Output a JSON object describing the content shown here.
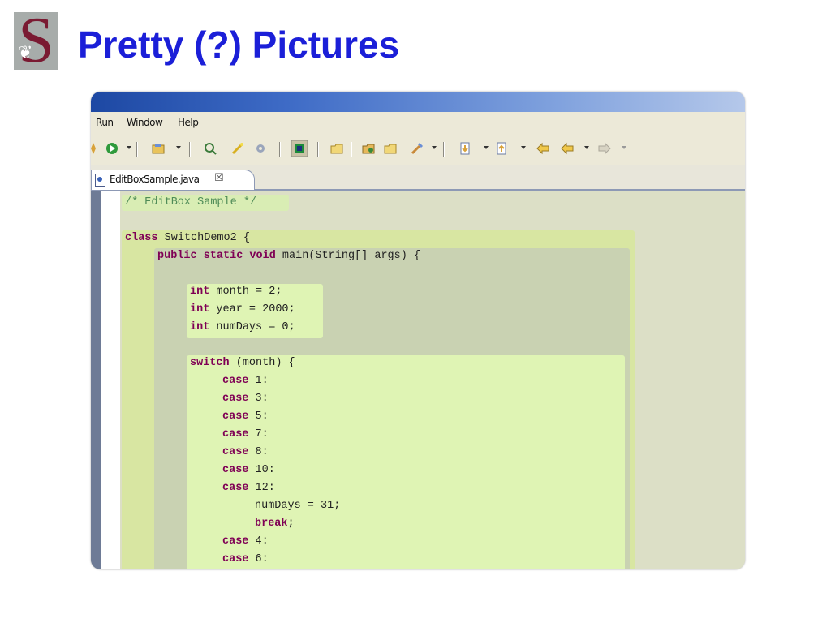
{
  "slide": {
    "title": "Pretty (?) Pictures",
    "logo_letter": "S"
  },
  "menu": [
    {
      "label": "Run",
      "mnemonic": "R"
    },
    {
      "label": "Window",
      "mnemonic": "W"
    },
    {
      "label": "Help",
      "mnemonic": "H"
    }
  ],
  "toolbar_icons": [
    "debug-icon",
    "run-icon",
    "open-type-icon",
    "search-icon",
    "wand-icon",
    "gear-icon",
    "perspective-icon",
    "open-folder-icon",
    "package-icon",
    "folder-icon",
    "brush-icon",
    "next-annotation-icon",
    "prev-annotation-icon",
    "back-icon",
    "forward-icon"
  ],
  "editor": {
    "tab_label": "EditBoxSample.java",
    "tab_close": "☒",
    "lines": [
      {
        "indent": 0,
        "parts": [
          {
            "text": "/* EditBox Sample */",
            "style": "comment"
          }
        ]
      },
      {
        "indent": 0,
        "parts": [
          {
            "text": "",
            "style": "plain"
          }
        ]
      },
      {
        "indent": 0,
        "parts": [
          {
            "text": "class",
            "style": "kw"
          },
          {
            "text": " SwitchDemo2 {",
            "style": "plain"
          }
        ]
      },
      {
        "indent": 1,
        "parts": [
          {
            "text": "public static void",
            "style": "kw"
          },
          {
            "text": " main(String[] args) {",
            "style": "plain"
          }
        ]
      },
      {
        "indent": 0,
        "parts": [
          {
            "text": "",
            "style": "plain"
          }
        ]
      },
      {
        "indent": 2,
        "parts": [
          {
            "text": "int",
            "style": "kw"
          },
          {
            "text": " month = 2;",
            "style": "plain"
          }
        ]
      },
      {
        "indent": 2,
        "parts": [
          {
            "text": "int",
            "style": "kw"
          },
          {
            "text": " year = 2000;",
            "style": "plain"
          }
        ]
      },
      {
        "indent": 2,
        "parts": [
          {
            "text": "int",
            "style": "kw"
          },
          {
            "text": " numDays = 0;",
            "style": "plain"
          }
        ]
      },
      {
        "indent": 0,
        "parts": [
          {
            "text": "",
            "style": "plain"
          }
        ]
      },
      {
        "indent": 2,
        "parts": [
          {
            "text": "switch",
            "style": "kw"
          },
          {
            "text": " (month) {",
            "style": "plain"
          }
        ]
      },
      {
        "indent": 3,
        "parts": [
          {
            "text": "case",
            "style": "kw"
          },
          {
            "text": " 1:",
            "style": "plain"
          }
        ]
      },
      {
        "indent": 3,
        "parts": [
          {
            "text": "case",
            "style": "kw"
          },
          {
            "text": " 3:",
            "style": "plain"
          }
        ]
      },
      {
        "indent": 3,
        "parts": [
          {
            "text": "case",
            "style": "kw"
          },
          {
            "text": " 5:",
            "style": "plain"
          }
        ]
      },
      {
        "indent": 3,
        "parts": [
          {
            "text": "case",
            "style": "kw"
          },
          {
            "text": " 7:",
            "style": "plain"
          }
        ]
      },
      {
        "indent": 3,
        "parts": [
          {
            "text": "case",
            "style": "kw"
          },
          {
            "text": " 8:",
            "style": "plain"
          }
        ]
      },
      {
        "indent": 3,
        "parts": [
          {
            "text": "case",
            "style": "kw"
          },
          {
            "text": " 10:",
            "style": "plain"
          }
        ]
      },
      {
        "indent": 3,
        "parts": [
          {
            "text": "case",
            "style": "kw"
          },
          {
            "text": " 12:",
            "style": "plain"
          }
        ]
      },
      {
        "indent": 4,
        "parts": [
          {
            "text": "numDays = 31;",
            "style": "plain"
          }
        ]
      },
      {
        "indent": 4,
        "parts": [
          {
            "text": "break",
            "style": "kw"
          },
          {
            "text": ";",
            "style": "plain"
          }
        ]
      },
      {
        "indent": 3,
        "parts": [
          {
            "text": "case",
            "style": "kw"
          },
          {
            "text": " 4:",
            "style": "plain"
          }
        ]
      },
      {
        "indent": 3,
        "parts": [
          {
            "text": "case",
            "style": "kw"
          },
          {
            "text": " 6:",
            "style": "plain"
          }
        ]
      }
    ]
  },
  "colors": {
    "title": "#1b1fd8",
    "keyword": "#7f0055",
    "comment": "#4f8c58",
    "scope_class": "#d8e6a2",
    "scope_method": "#c9d2b2",
    "scope_block": "#dff4b4"
  }
}
